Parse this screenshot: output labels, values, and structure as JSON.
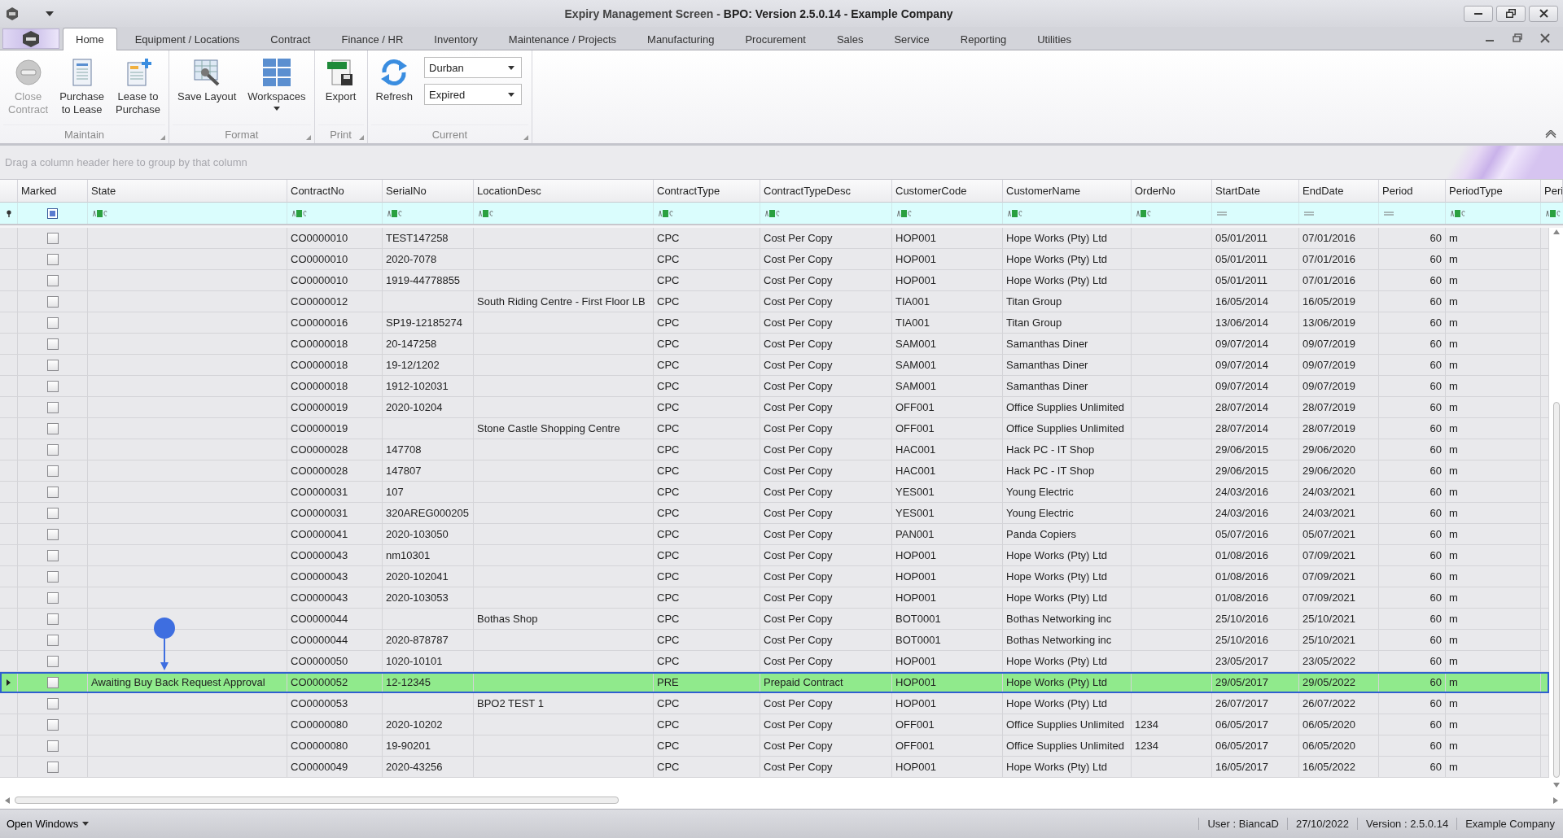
{
  "window": {
    "title": "Expiry Management Screen - **BPO: Version 2.5.0.14 - Example Company**"
  },
  "tabs": [
    {
      "label": "Home",
      "selected": true
    },
    {
      "label": "Equipment / Locations",
      "selected": false
    },
    {
      "label": "Contract",
      "selected": false
    },
    {
      "label": "Finance / HR",
      "selected": false
    },
    {
      "label": "Inventory",
      "selected": false
    },
    {
      "label": "Maintenance / Projects",
      "selected": false
    },
    {
      "label": "Manufacturing",
      "selected": false
    },
    {
      "label": "Procurement",
      "selected": false
    },
    {
      "label": "Sales",
      "selected": false
    },
    {
      "label": "Service",
      "selected": false
    },
    {
      "label": "Reporting",
      "selected": false
    },
    {
      "label": "Utilities",
      "selected": false
    }
  ],
  "ribbon": [
    {
      "label": "Maintain",
      "items": [
        {
          "kind": "button",
          "label": "Close\nContract",
          "disabled": true
        },
        {
          "kind": "button",
          "label": "Purchase\nto Lease",
          "disabled": false
        },
        {
          "kind": "button",
          "label": "Lease to\nPurchase",
          "disabled": false
        }
      ]
    },
    {
      "label": "Format",
      "items": [
        {
          "kind": "button",
          "label": "Save Layout",
          "disabled": false
        },
        {
          "kind": "dropdown-button",
          "label": "Workspaces",
          "disabled": false
        }
      ]
    },
    {
      "label": "Print",
      "items": [
        {
          "kind": "button",
          "label": "Export",
          "disabled": false
        }
      ]
    },
    {
      "label": "Current",
      "items": [
        {
          "kind": "button",
          "label": "Refresh",
          "disabled": false
        },
        {
          "kind": "combos",
          "values": [
            "Durban",
            "Expired"
          ]
        }
      ]
    }
  ],
  "group_panel": {
    "placeholder": "Drag a column header here to group by that column"
  },
  "table": {
    "columns": [
      {
        "label": "Marked",
        "kind": "check"
      },
      {
        "label": "State",
        "kind": "text"
      },
      {
        "label": "ContractNo",
        "kind": "text"
      },
      {
        "label": "SerialNo",
        "kind": "text"
      },
      {
        "label": "LocationDesc",
        "kind": "text"
      },
      {
        "label": "ContractType",
        "kind": "text"
      },
      {
        "label": "ContractTypeDesc",
        "kind": "text"
      },
      {
        "label": "CustomerCode",
        "kind": "text"
      },
      {
        "label": "CustomerName",
        "kind": "text"
      },
      {
        "label": "OrderNo",
        "kind": "text"
      },
      {
        "label": "StartDate",
        "kind": "date"
      },
      {
        "label": "EndDate",
        "kind": "date"
      },
      {
        "label": "Period",
        "kind": "number"
      },
      {
        "label": "PeriodType",
        "kind": "text"
      },
      {
        "label": "Peri",
        "kind": "text"
      }
    ],
    "rows": [
      {
        "marked": false,
        "selected": false,
        "cells": [
          "",
          "",
          "CO0000010",
          "TEST147258",
          "",
          "CPC",
          "Cost Per Copy",
          "HOP001",
          "Hope Works (Pty) Ltd",
          "",
          "05/01/2011",
          "07/01/2016",
          "60",
          "m"
        ]
      },
      {
        "marked": false,
        "selected": false,
        "cells": [
          "",
          "",
          "CO0000010",
          "2020-7078",
          "",
          "CPC",
          "Cost Per Copy",
          "HOP001",
          "Hope Works (Pty) Ltd",
          "",
          "05/01/2011",
          "07/01/2016",
          "60",
          "m"
        ]
      },
      {
        "marked": false,
        "selected": false,
        "cells": [
          "",
          "",
          "CO0000010",
          "1919-44778855",
          "",
          "CPC",
          "Cost Per Copy",
          "HOP001",
          "Hope Works (Pty) Ltd",
          "",
          "05/01/2011",
          "07/01/2016",
          "60",
          "m"
        ]
      },
      {
        "marked": false,
        "selected": false,
        "cells": [
          "",
          "",
          "CO0000012",
          "",
          "South Riding Centre - First Floor LB",
          "CPC",
          "Cost Per Copy",
          "TIA001",
          "Titan Group",
          "",
          "16/05/2014",
          "16/05/2019",
          "60",
          "m"
        ]
      },
      {
        "marked": false,
        "selected": false,
        "cells": [
          "",
          "",
          "CO0000016",
          "SP19-12185274",
          "",
          "CPC",
          "Cost Per Copy",
          "TIA001",
          "Titan Group",
          "",
          "13/06/2014",
          "13/06/2019",
          "60",
          "m"
        ]
      },
      {
        "marked": false,
        "selected": false,
        "cells": [
          "",
          "",
          "CO0000018",
          "20-147258",
          "",
          "CPC",
          "Cost Per Copy",
          "SAM001",
          "Samanthas Diner",
          "",
          "09/07/2014",
          "09/07/2019",
          "60",
          "m"
        ]
      },
      {
        "marked": false,
        "selected": false,
        "cells": [
          "",
          "",
          "CO0000018",
          "19-12/1202",
          "",
          "CPC",
          "Cost Per Copy",
          "SAM001",
          "Samanthas Diner",
          "",
          "09/07/2014",
          "09/07/2019",
          "60",
          "m"
        ]
      },
      {
        "marked": false,
        "selected": false,
        "cells": [
          "",
          "",
          "CO0000018",
          "1912-102031",
          "",
          "CPC",
          "Cost Per Copy",
          "SAM001",
          "Samanthas Diner",
          "",
          "09/07/2014",
          "09/07/2019",
          "60",
          "m"
        ]
      },
      {
        "marked": false,
        "selected": false,
        "cells": [
          "",
          "",
          "CO0000019",
          "2020-10204",
          "",
          "CPC",
          "Cost Per Copy",
          "OFF001",
          "Office Supplies Unlimited",
          "",
          "28/07/2014",
          "28/07/2019",
          "60",
          "m"
        ]
      },
      {
        "marked": false,
        "selected": false,
        "cells": [
          "",
          "",
          "CO0000019",
          "",
          "Stone Castle Shopping Centre",
          "CPC",
          "Cost Per Copy",
          "OFF001",
          "Office Supplies Unlimited",
          "",
          "28/07/2014",
          "28/07/2019",
          "60",
          "m"
        ]
      },
      {
        "marked": false,
        "selected": false,
        "cells": [
          "",
          "",
          "CO0000028",
          "147708",
          "",
          "CPC",
          "Cost Per Copy",
          "HAC001",
          "Hack PC - IT Shop",
          "",
          "29/06/2015",
          "29/06/2020",
          "60",
          "m"
        ]
      },
      {
        "marked": false,
        "selected": false,
        "cells": [
          "",
          "",
          "CO0000028",
          "147807",
          "",
          "CPC",
          "Cost Per Copy",
          "HAC001",
          "Hack PC - IT Shop",
          "",
          "29/06/2015",
          "29/06/2020",
          "60",
          "m"
        ]
      },
      {
        "marked": false,
        "selected": false,
        "cells": [
          "",
          "",
          "CO0000031",
          "107",
          "",
          "CPC",
          "Cost Per Copy",
          "YES001",
          "Young Electric",
          "",
          "24/03/2016",
          "24/03/2021",
          "60",
          "m"
        ]
      },
      {
        "marked": false,
        "selected": false,
        "cells": [
          "",
          "",
          "CO0000031",
          "320AREG000205",
          "",
          "CPC",
          "Cost Per Copy",
          "YES001",
          "Young Electric",
          "",
          "24/03/2016",
          "24/03/2021",
          "60",
          "m"
        ]
      },
      {
        "marked": false,
        "selected": false,
        "cells": [
          "",
          "",
          "CO0000041",
          "2020-103050",
          "",
          "CPC",
          "Cost Per Copy",
          "PAN001",
          "Panda Copiers",
          "",
          "05/07/2016",
          "05/07/2021",
          "60",
          "m"
        ]
      },
      {
        "marked": false,
        "selected": false,
        "cells": [
          "",
          "",
          "CO0000043",
          "nm10301",
          "",
          "CPC",
          "Cost Per Copy",
          "HOP001",
          "Hope Works (Pty) Ltd",
          "",
          "01/08/2016",
          "07/09/2021",
          "60",
          "m"
        ]
      },
      {
        "marked": false,
        "selected": false,
        "cells": [
          "",
          "",
          "CO0000043",
          "2020-102041",
          "",
          "CPC",
          "Cost Per Copy",
          "HOP001",
          "Hope Works (Pty) Ltd",
          "",
          "01/08/2016",
          "07/09/2021",
          "60",
          "m"
        ]
      },
      {
        "marked": false,
        "selected": false,
        "cells": [
          "",
          "",
          "CO0000043",
          "2020-103053",
          "",
          "CPC",
          "Cost Per Copy",
          "HOP001",
          "Hope Works (Pty) Ltd",
          "",
          "01/08/2016",
          "07/09/2021",
          "60",
          "m"
        ]
      },
      {
        "marked": false,
        "selected": false,
        "cells": [
          "",
          "",
          "CO0000044",
          "",
          "Bothas Shop",
          "CPC",
          "Cost Per Copy",
          "BOT0001",
          "Bothas Networking inc",
          "",
          "25/10/2016",
          "25/10/2021",
          "60",
          "m"
        ]
      },
      {
        "marked": false,
        "selected": false,
        "cells": [
          "",
          "",
          "CO0000044",
          "2020-878787",
          "",
          "CPC",
          "Cost Per Copy",
          "BOT0001",
          "Bothas Networking inc",
          "",
          "25/10/2016",
          "25/10/2021",
          "60",
          "m"
        ]
      },
      {
        "marked": false,
        "selected": false,
        "cells": [
          "",
          "",
          "CO0000050",
          "1020-10101",
          "",
          "CPC",
          "Cost Per Copy",
          "HOP001",
          "Hope Works (Pty) Ltd",
          "",
          "23/05/2017",
          "23/05/2022",
          "60",
          "m"
        ]
      },
      {
        "marked": false,
        "selected": true,
        "cells": [
          "",
          "Awaiting Buy Back Request Approval",
          "CO0000052",
          "12-12345",
          "",
          "PRE",
          "Prepaid Contract",
          "HOP001",
          "Hope Works (Pty) Ltd",
          "",
          "29/05/2017",
          "29/05/2022",
          "60",
          "m"
        ]
      },
      {
        "marked": false,
        "selected": false,
        "cells": [
          "",
          "",
          "CO0000053",
          "",
          "BPO2 TEST 1",
          "CPC",
          "Cost Per Copy",
          "HOP001",
          "Hope Works (Pty) Ltd",
          "",
          "26/07/2017",
          "26/07/2022",
          "60",
          "m"
        ]
      },
      {
        "marked": false,
        "selected": false,
        "cells": [
          "",
          "",
          "CO0000080",
          "2020-10202",
          "",
          "CPC",
          "Cost Per Copy",
          "OFF001",
          "Office Supplies Unlimited",
          "1234",
          "06/05/2017",
          "06/05/2020",
          "60",
          "m"
        ]
      },
      {
        "marked": false,
        "selected": false,
        "cells": [
          "",
          "",
          "CO0000080",
          "19-90201",
          "",
          "CPC",
          "Cost Per Copy",
          "OFF001",
          "Office Supplies Unlimited",
          "1234",
          "06/05/2017",
          "06/05/2020",
          "60",
          "m"
        ]
      },
      {
        "marked": false,
        "selected": false,
        "cells": [
          "",
          "",
          "CO0000049",
          "2020-43256",
          "",
          "CPC",
          "Cost Per Copy",
          "HOP001",
          "Hope Works (Pty) Ltd",
          "",
          "16/05/2017",
          "16/05/2022",
          "60",
          "m"
        ]
      }
    ]
  },
  "status_bar": {
    "menu": "Open Windows",
    "items": [
      "User : BiancaD",
      "27/10/2022",
      "Version : 2.5.0.14",
      "Example Company"
    ]
  }
}
